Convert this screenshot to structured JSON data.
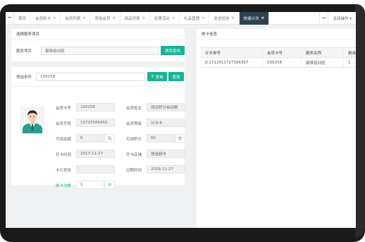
{
  "tabs": {
    "left_arrow": "⏮",
    "items": [
      {
        "label": "首页",
        "close": ""
      },
      {
        "label": "会员刷卡",
        "close": "⊗"
      },
      {
        "label": "会员列表",
        "close": "⊗"
      },
      {
        "label": "添加会员",
        "close": "⊗"
      },
      {
        "label": "商品列表",
        "close": "⊗"
      },
      {
        "label": "优惠活动",
        "close": "⊗"
      },
      {
        "label": "礼品管理",
        "close": "⊗"
      },
      {
        "label": "发送短信",
        "close": "⊗"
      },
      {
        "label": "快速计次",
        "close": "⊗"
      }
    ],
    "right_arrow": "⏭",
    "close_ops": "关闭操作 ▾"
  },
  "service_panel": {
    "title": "选择服务项目",
    "label": "服务项目",
    "value": "钢琴培训班",
    "button": "项目查找"
  },
  "member_panel": {
    "filter_label": "筛选条件",
    "filter_value": "100258",
    "query_button": "查询",
    "find_button": "查找",
    "fields": {
      "card_no_label": "会员卡号",
      "card_no": "100258",
      "name_label": "会员姓名",
      "name": "测试积分自动刷",
      "phone_label": "会员手机",
      "phone": "13725589452",
      "level_label": "会员等级",
      "level": "计次卡",
      "balance_label": "可用余额",
      "balance": "0",
      "balance_unit": "元",
      "points_label": "可用积分",
      "points": "66",
      "points_unit": "分",
      "open_time_label": "开卡时间",
      "open_time": "2017-11-27",
      "open_store_label": "开卡店铺",
      "open_store": "快送超市",
      "card_status_label": "卡片状态",
      "card_status": "",
      "expire_label": "过期时间",
      "expire": "2018-11-27",
      "count_label": "刷卡次数",
      "count": "1",
      "count_unit": "次"
    }
  },
  "swipe_panel": {
    "title": "刷卡信息",
    "columns": [
      "计次单号",
      "会员卡号",
      "服务名称",
      "剩余"
    ],
    "rows": [
      [
        "JC1712011727306367",
        "100258",
        "钢琴培训班",
        "1"
      ]
    ]
  },
  "colors": {
    "accent": "#1ab394",
    "active_tab": "#2f4050",
    "frame": "#1a1a1a"
  }
}
